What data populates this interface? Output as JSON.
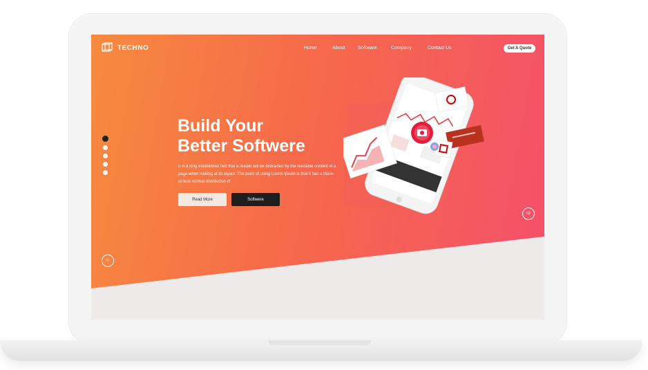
{
  "brand": {
    "name": "TECHNO"
  },
  "nav": {
    "items": [
      "Home",
      "About",
      "Software",
      "Company",
      "Contact Us"
    ]
  },
  "header": {
    "cta_label": "Get A Quote"
  },
  "hero": {
    "title_line1": "Build Your",
    "title_line2": "Better Softwere",
    "description": "It is a long established fact that a reader will be distracted by the readable content of a page when looking at its layout. The point of using Lorem Ipsum is that it has a more-or-less normal distribution of",
    "read_more_label": "Read More",
    "software_label": "Softwere"
  },
  "slider": {
    "current": "01",
    "next": "02",
    "dot_count": 5,
    "active_dot": 0
  },
  "colors": {
    "gradient_start": "#f78a3f",
    "gradient_end": "#f4506a",
    "band": "#efeaea",
    "dark_button": "#1e1e1e"
  },
  "icons": {
    "logo": "cube-outline-icon",
    "camera": "camera-icon"
  }
}
